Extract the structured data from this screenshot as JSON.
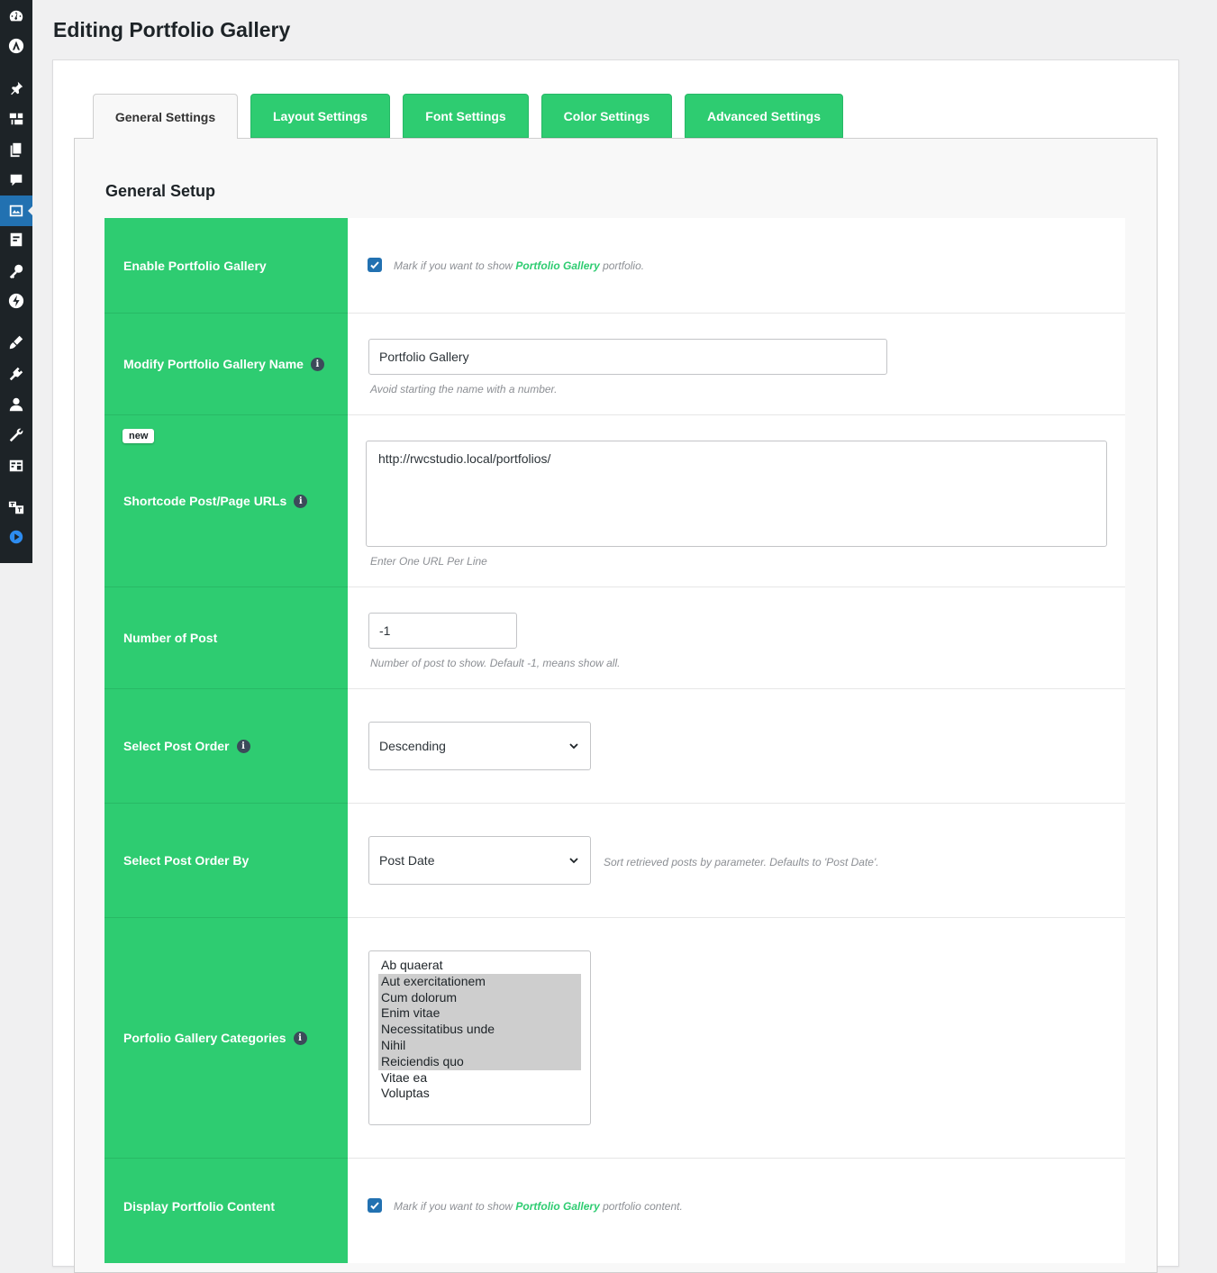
{
  "page": {
    "title": "Editing Portfolio Gallery"
  },
  "sidebar": {
    "icons": [
      "dashboard-icon",
      "astra-icon",
      "pin-icon",
      "media-icon",
      "pages-icon",
      "comments-icon",
      "portfolio-icon",
      "forms-icon",
      "key-icon",
      "lightning-icon",
      "appearance-icon",
      "plugins-icon",
      "users-icon",
      "tools-icon",
      "settings-icon",
      "translate-icon",
      "play-icon"
    ]
  },
  "tabs": [
    {
      "label": "General Settings",
      "active": true
    },
    {
      "label": "Layout Settings"
    },
    {
      "label": "Font Settings"
    },
    {
      "label": "Color Settings"
    },
    {
      "label": "Advanced Settings"
    }
  ],
  "section": {
    "title": "General Setup"
  },
  "rows": {
    "enable": {
      "label": "Enable Portfolio Gallery",
      "checked": true,
      "hint_pre": "Mark if you want to show ",
      "hint_hl": "Portfolio Gallery",
      "hint_post": " portfolio."
    },
    "name": {
      "label": "Modify Portfolio Gallery Name",
      "value": "Portfolio Gallery",
      "hint": "Avoid starting the name with a number."
    },
    "urls": {
      "badge": "new",
      "label": "Shortcode Post/Page URLs",
      "value": "http://rwcstudio.local/portfolios/",
      "hint": "Enter One URL Per Line"
    },
    "number": {
      "label": "Number of Post",
      "value": "-1",
      "hint": "Number of post to show. Default -1, means show all."
    },
    "order": {
      "label": "Select Post Order",
      "value": "Descending"
    },
    "orderby": {
      "label": "Select Post Order By",
      "value": "Post Date",
      "hint": "Sort retrieved posts by parameter. Defaults to 'Post Date'."
    },
    "categories": {
      "label": "Porfolio Gallery Categories",
      "options": [
        {
          "label": "Ab quaerat",
          "selected": false
        },
        {
          "label": "Aut exercitationem",
          "selected": true
        },
        {
          "label": "Cum dolorum",
          "selected": true
        },
        {
          "label": "Enim vitae",
          "selected": true
        },
        {
          "label": "Necessitatibus unde",
          "selected": true
        },
        {
          "label": "Nihil",
          "selected": true
        },
        {
          "label": "Reiciendis quo",
          "selected": true
        },
        {
          "label": "Vitae ea",
          "selected": false
        },
        {
          "label": "Voluptas",
          "selected": false
        }
      ]
    },
    "content": {
      "label": "Display Portfolio Content",
      "checked": true,
      "hint_pre": "Mark if you want to show ",
      "hint_hl": "Portfolio Gallery",
      "hint_post": " portfolio content."
    }
  },
  "colors": {
    "accent_green": "#2ecc71",
    "admin_sidebar": "#1d2327",
    "active_menu": "#2271b1"
  }
}
